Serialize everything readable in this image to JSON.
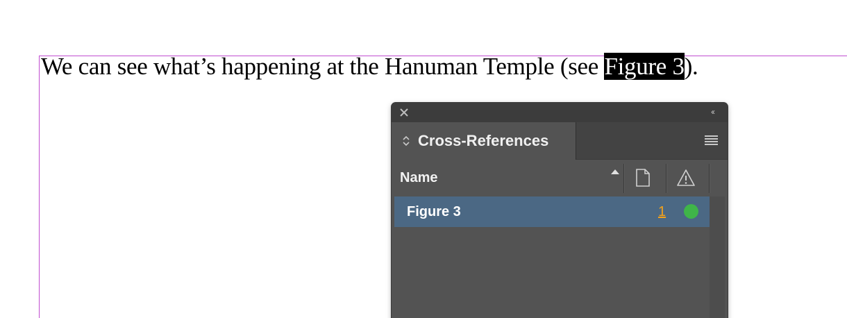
{
  "document": {
    "text_before": "We can see what’s happening at the Hanuman Temple (see ",
    "selected_text": "Figure 3",
    "text_after": ")."
  },
  "panel": {
    "close_icon": "close-icon",
    "collapse_icon": "double-chevron-left-icon",
    "collapse_glyph": "‹‹",
    "tab_label": "Cross-References",
    "menu_icon": "hamburger-menu-icon",
    "columns": {
      "name": "Name",
      "page_icon": "page-icon",
      "status_icon": "warning-icon"
    },
    "rows": [
      {
        "name": "Figure 3",
        "page": "1",
        "status": "up-to-date",
        "status_color": "#3fb549",
        "selected": true
      }
    ]
  },
  "colors": {
    "guide": "#c04cd0",
    "panel_bg": "#535353",
    "row_selected": "#4b6884",
    "page_link": "#f4a21a"
  }
}
